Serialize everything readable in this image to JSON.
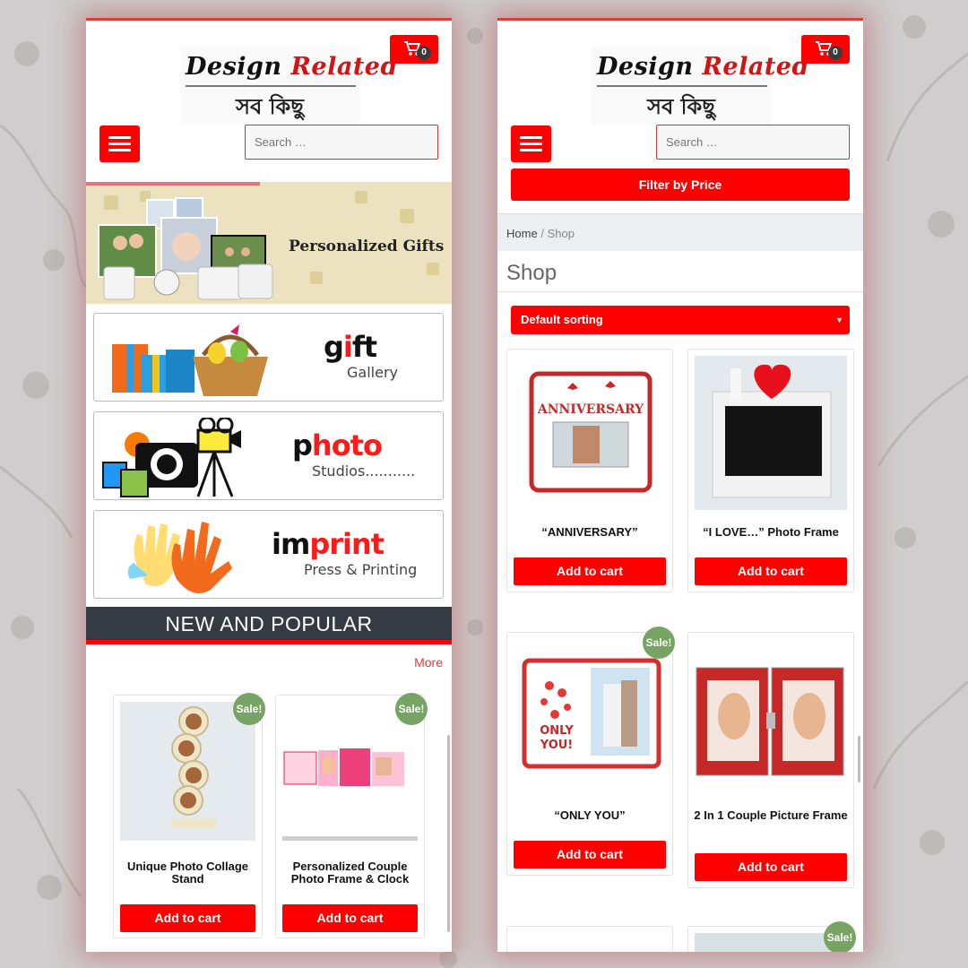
{
  "brand": {
    "name_part1": "Design",
    "name_part2": "Related",
    "tagline": "সব কিছু"
  },
  "cart": {
    "count": "0"
  },
  "search": {
    "placeholder": "Search …"
  },
  "left": {
    "banner_title": "Personalized Gifts",
    "promos": [
      {
        "word_dark": "g",
        "word_red": "i",
        "word_rest": "ft",
        "sub": "Gallery"
      },
      {
        "word_dark": "p",
        "word_red": "hoto",
        "word_rest": "",
        "sub": "Studios..........."
      },
      {
        "word_dark": "im",
        "word_red": "print",
        "word_rest": "",
        "sub": "Press & Printing"
      }
    ],
    "section_title": "NEW AND POPULAR",
    "more_link": "More",
    "products": [
      {
        "name": "Unique Photo Collage Stand",
        "sale": "Sale!",
        "button": "Add to cart"
      },
      {
        "name": "Personalized Couple Photo Frame & Clock",
        "sale": "Sale!",
        "button": "Add to cart"
      }
    ]
  },
  "right": {
    "filter_button": "Filter by Price",
    "breadcrumb": {
      "home": "Home",
      "separator": "/",
      "current": "Shop"
    },
    "page_title": "Shop",
    "sorting": "Default sorting",
    "products": [
      {
        "name": "“ANNIVERSARY”",
        "button": "Add to cart"
      },
      {
        "name": "“I LOVE…” Photo Frame",
        "button": "Add to cart"
      },
      {
        "name": "“ONLY YOU”",
        "sale": "Sale!",
        "button": "Add to cart"
      },
      {
        "name": "2 In 1 Couple Picture Frame",
        "button": "Add to cart"
      },
      {
        "name": "",
        "button": ""
      },
      {
        "name": "",
        "sale": "Sale!",
        "button": ""
      }
    ],
    "image_texts": {
      "anniversary": "ANNIVERSARY",
      "only_you_1": "ONLY",
      "only_you_2": "YOU!"
    }
  },
  "colors": {
    "accent": "#ff0000",
    "dark_bar": "#353b45",
    "sale_badge": "#77a464",
    "page_bg": "#cfcdcd"
  }
}
